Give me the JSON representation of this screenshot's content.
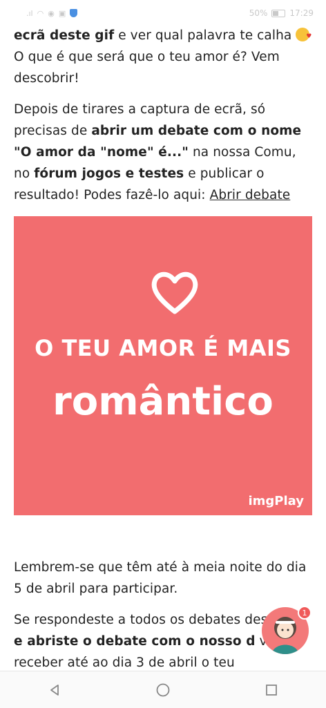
{
  "status": {
    "battery_text": "50%",
    "time": "17:29",
    "battery_level": 0.5
  },
  "p1": {
    "b1": "ecrã deste gif",
    "t1": " e ver qual palavra te calha ",
    "t2": " O que é que será que o teu amor é? Vem descobrir!",
    "emoji_icon": "kissing-face-icon"
  },
  "p2": {
    "t1": "Depois de tirares a captura de ecrã, só precisas de ",
    "b1": "abrir um debate com o nome \"O amor da \"nome\" é...\"",
    "t2": " na nossa Comu, no ",
    "b2": "fórum jogos e testes",
    "t3": " e publicar o resultado! Podes fazê-lo aqui: ",
    "link": "Abrir debate"
  },
  "gif": {
    "line1": "O TEU AMOR É MAIS",
    "line2": "romântico",
    "watermark": "imgPlay",
    "background": "#f26d6f"
  },
  "p3": {
    "t1": "Lembrem-se que têm até à meia noite do dia 5 de abril para participar."
  },
  "p4": {
    "t1": "Se respondeste a todos os debates des",
    "t1b": " teste ",
    "b1": "e abriste o debate com o nosso d",
    "t2": " vais receber até ao dia 3 de abril o teu"
  },
  "floating": {
    "badge_count": "1"
  }
}
